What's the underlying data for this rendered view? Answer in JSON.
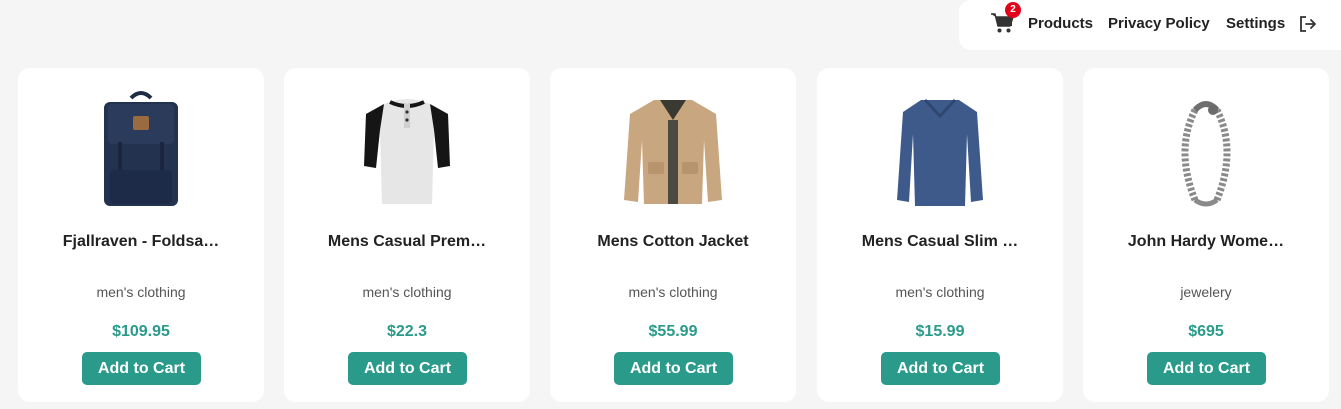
{
  "nav": {
    "cart_count": "2",
    "products_label": "Products",
    "privacy_label": "Privacy Policy",
    "settings_label": "Settings",
    "icons": {
      "cart": "cart-icon",
      "logout": "logout-icon"
    }
  },
  "colors": {
    "accent": "#2a9a8a",
    "badge": "#e2001a",
    "background": "#f5f5f5",
    "card": "#ffffff"
  },
  "products": [
    {
      "title": "Fjallraven - Foldsa…",
      "category": "men's clothing",
      "price": "$109.95",
      "button": "Add to Cart"
    },
    {
      "title": "Mens Casual Prem…",
      "category": "men's clothing",
      "price": "$22.3",
      "button": "Add to Cart"
    },
    {
      "title": "Mens Cotton Jacket",
      "category": "men's clothing",
      "price": "$55.99",
      "button": "Add to Cart"
    },
    {
      "title": "Mens Casual Slim …",
      "category": "men's clothing",
      "price": "$15.99",
      "button": "Add to Cart"
    },
    {
      "title": "John Hardy Wome…",
      "category": "jewelery",
      "price": "$695",
      "button": "Add to Cart"
    }
  ]
}
